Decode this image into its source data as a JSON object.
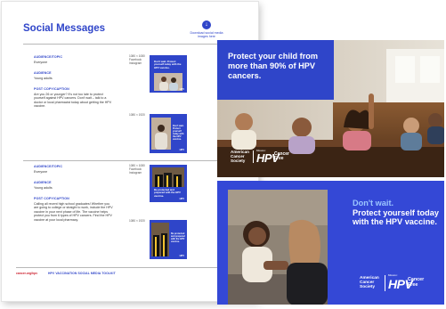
{
  "toolkit": {
    "title": "Social Messages",
    "download_icon": "↓",
    "download_label": "Download social media images here",
    "posts": [
      {
        "audience_topic_label": "AUDIENCE/TOPIC",
        "audience_topic_value": "Everyone",
        "audience_label": "AUDIENCE",
        "audience_value": "Young adults",
        "caption_label": "POST COPY/CAPTION",
        "caption_value": "Are you 26 or younger? It's not too late to protect yourself against HPV cancers. Don't wait – talk to a doctor or local pharmacist today about getting the HPV vaccine.",
        "size_a": "1080 × 1080 Facebook Instagram",
        "size_b": "1080 × 1920",
        "thumb_a_text": "Don't wait. Protect yourself today with the HPV vaccine.",
        "thumb_b_text": "Don't wait. Protect yourself today with the HPV vaccine."
      },
      {
        "audience_topic_label": "AUDIENCE/TOPIC",
        "audience_topic_value": "Everyone",
        "audience_label": "AUDIENCE",
        "audience_value": "Young adults",
        "caption_label": "POST COPY/CAPTION",
        "caption_value": "Calling all recent high school graduates! Whether you are going to college or straight to work, include the HPV vaccine in your next phase of life. The vaccine helps protect you from 6 types of HPV cancers. Find the HPV vaccine at your local pharmacy.",
        "size_a": "1080 × 1080 Facebook Instagram",
        "size_b": "1080 × 1920",
        "thumb_a_text": "Be protected and prepared with the HPV vaccine.",
        "thumb_b_text": "Be protected and prepared with the HPV vaccine."
      }
    ],
    "thumb_logo": "HPV",
    "footer_url": "cancer.org/hpv",
    "footer_title": "HPV VACCINATION SOCIAL MEDIA TOOLKIT"
  },
  "ad_children": {
    "headline": "Protect your child from more than 90% of HPV cancers."
  },
  "ad_young_adult": {
    "headline_line1": "Don't wait.",
    "headline_rest": "Protect yourself today with the HPV vaccine."
  },
  "logos": {
    "acs": "American Cancer Society",
    "mission": "Mission:",
    "hpv": "HPV",
    "cancer_free": "Cancer Free"
  },
  "colors": {
    "brand_blue": "#2f45c9",
    "ad_blue": "#3448d6",
    "headline_light_blue": "#9cc6ff",
    "acs_red": "#cc1f2d"
  }
}
